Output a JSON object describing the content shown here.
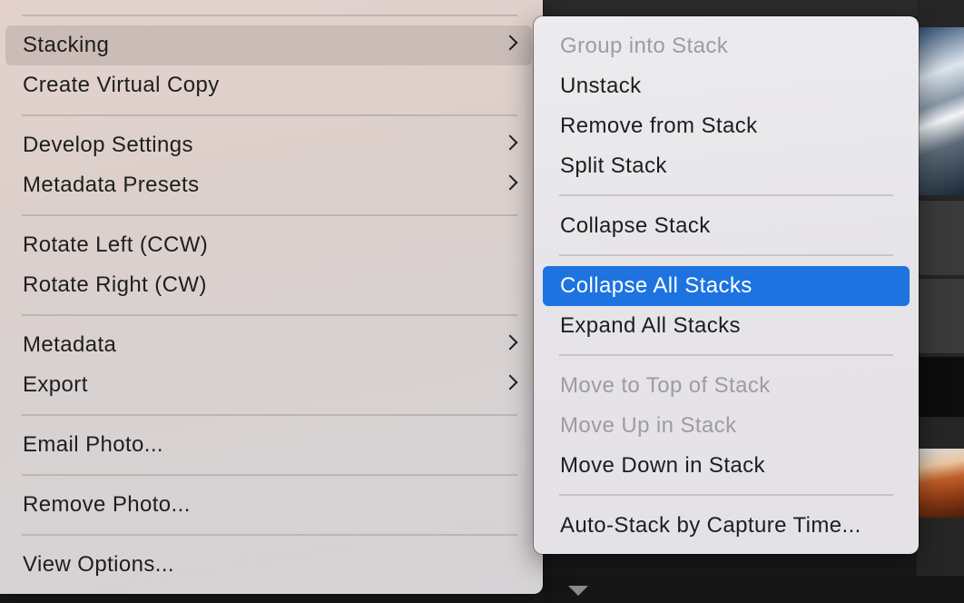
{
  "main_menu": {
    "items": [
      {
        "label": "Stacking",
        "submenu": true
      },
      {
        "label": "Create Virtual Copy",
        "submenu": false
      },
      {
        "label": "Develop Settings",
        "submenu": true
      },
      {
        "label": "Metadata Presets",
        "submenu": true
      },
      {
        "label": "Rotate Left (CCW)",
        "submenu": false
      },
      {
        "label": "Rotate Right (CW)",
        "submenu": false
      },
      {
        "label": "Metadata",
        "submenu": true
      },
      {
        "label": "Export",
        "submenu": true
      },
      {
        "label": "Email Photo...",
        "submenu": false
      },
      {
        "label": "Remove Photo...",
        "submenu": false
      },
      {
        "label": "View Options...",
        "submenu": false
      }
    ]
  },
  "stacking_submenu": {
    "items": [
      {
        "label": "Group into Stack",
        "enabled": false
      },
      {
        "label": "Unstack",
        "enabled": true
      },
      {
        "label": "Remove from Stack",
        "enabled": true
      },
      {
        "label": "Split Stack",
        "enabled": true
      },
      {
        "label": "Collapse Stack",
        "enabled": true
      },
      {
        "label": "Collapse All Stacks",
        "enabled": true,
        "selected": true
      },
      {
        "label": "Expand All Stacks",
        "enabled": true
      },
      {
        "label": "Move to Top of Stack",
        "enabled": false
      },
      {
        "label": "Move Up in Stack",
        "enabled": false
      },
      {
        "label": "Move Down in Stack",
        "enabled": true
      },
      {
        "label": "Auto-Stack by Capture Time...",
        "enabled": true
      }
    ]
  },
  "colors": {
    "selection": "#1d73e0",
    "enabled_text": "#1e1e1e",
    "disabled_text": "#9e9ca0"
  }
}
